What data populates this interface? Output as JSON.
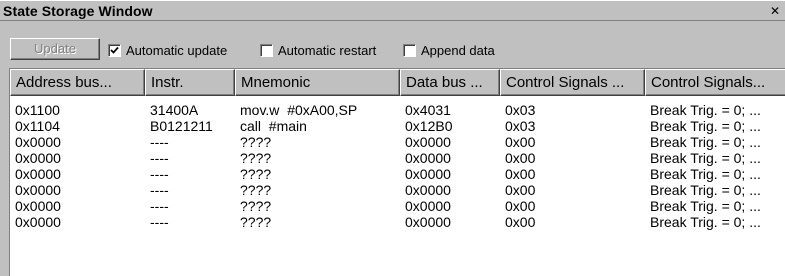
{
  "window": {
    "title": "State Storage Window",
    "close_glyph": "✕"
  },
  "toolbar": {
    "update_label": "Update",
    "options": [
      {
        "label": "Automatic update",
        "checked": true
      },
      {
        "label": "Automatic restart",
        "checked": false
      },
      {
        "label": "Append data",
        "checked": false
      }
    ]
  },
  "table": {
    "columns": [
      "Address bus...",
      "Instr.",
      "Mnemonic",
      "Data bus ...",
      "Control Signals ...",
      "Control Signals..."
    ],
    "rows": [
      [
        "0x1100",
        "31400A",
        "mov.w  #0xA00,SP",
        "0x4031",
        "0x03",
        "Break Trig. = 0; ..."
      ],
      [
        "0x1104",
        "B0121211",
        "call  #main",
        "0x12B0",
        "0x03",
        "Break Trig. = 0; ..."
      ],
      [
        "0x0000",
        "----",
        "????",
        "0x0000",
        "0x00",
        "Break Trig. = 0; ..."
      ],
      [
        "0x0000",
        "----",
        "????",
        "0x0000",
        "0x00",
        "Break Trig. = 0; ..."
      ],
      [
        "0x0000",
        "----",
        "????",
        "0x0000",
        "0x00",
        "Break Trig. = 0; ..."
      ],
      [
        "0x0000",
        "----",
        "????",
        "0x0000",
        "0x00",
        "Break Trig. = 0; ..."
      ],
      [
        "0x0000",
        "----",
        "????",
        "0x0000",
        "0x00",
        "Break Trig. = 0; ..."
      ],
      [
        "0x0000",
        "----",
        "????",
        "0x0000",
        "0x00",
        "Break Trig. = 0; ..."
      ]
    ]
  },
  "colors": {
    "window_bg": "#c0c0c0",
    "grid_bg": "#ffffff",
    "disabled_text": "#808080"
  },
  "icons": {
    "close": "close-icon",
    "check": "checkmark-icon"
  }
}
